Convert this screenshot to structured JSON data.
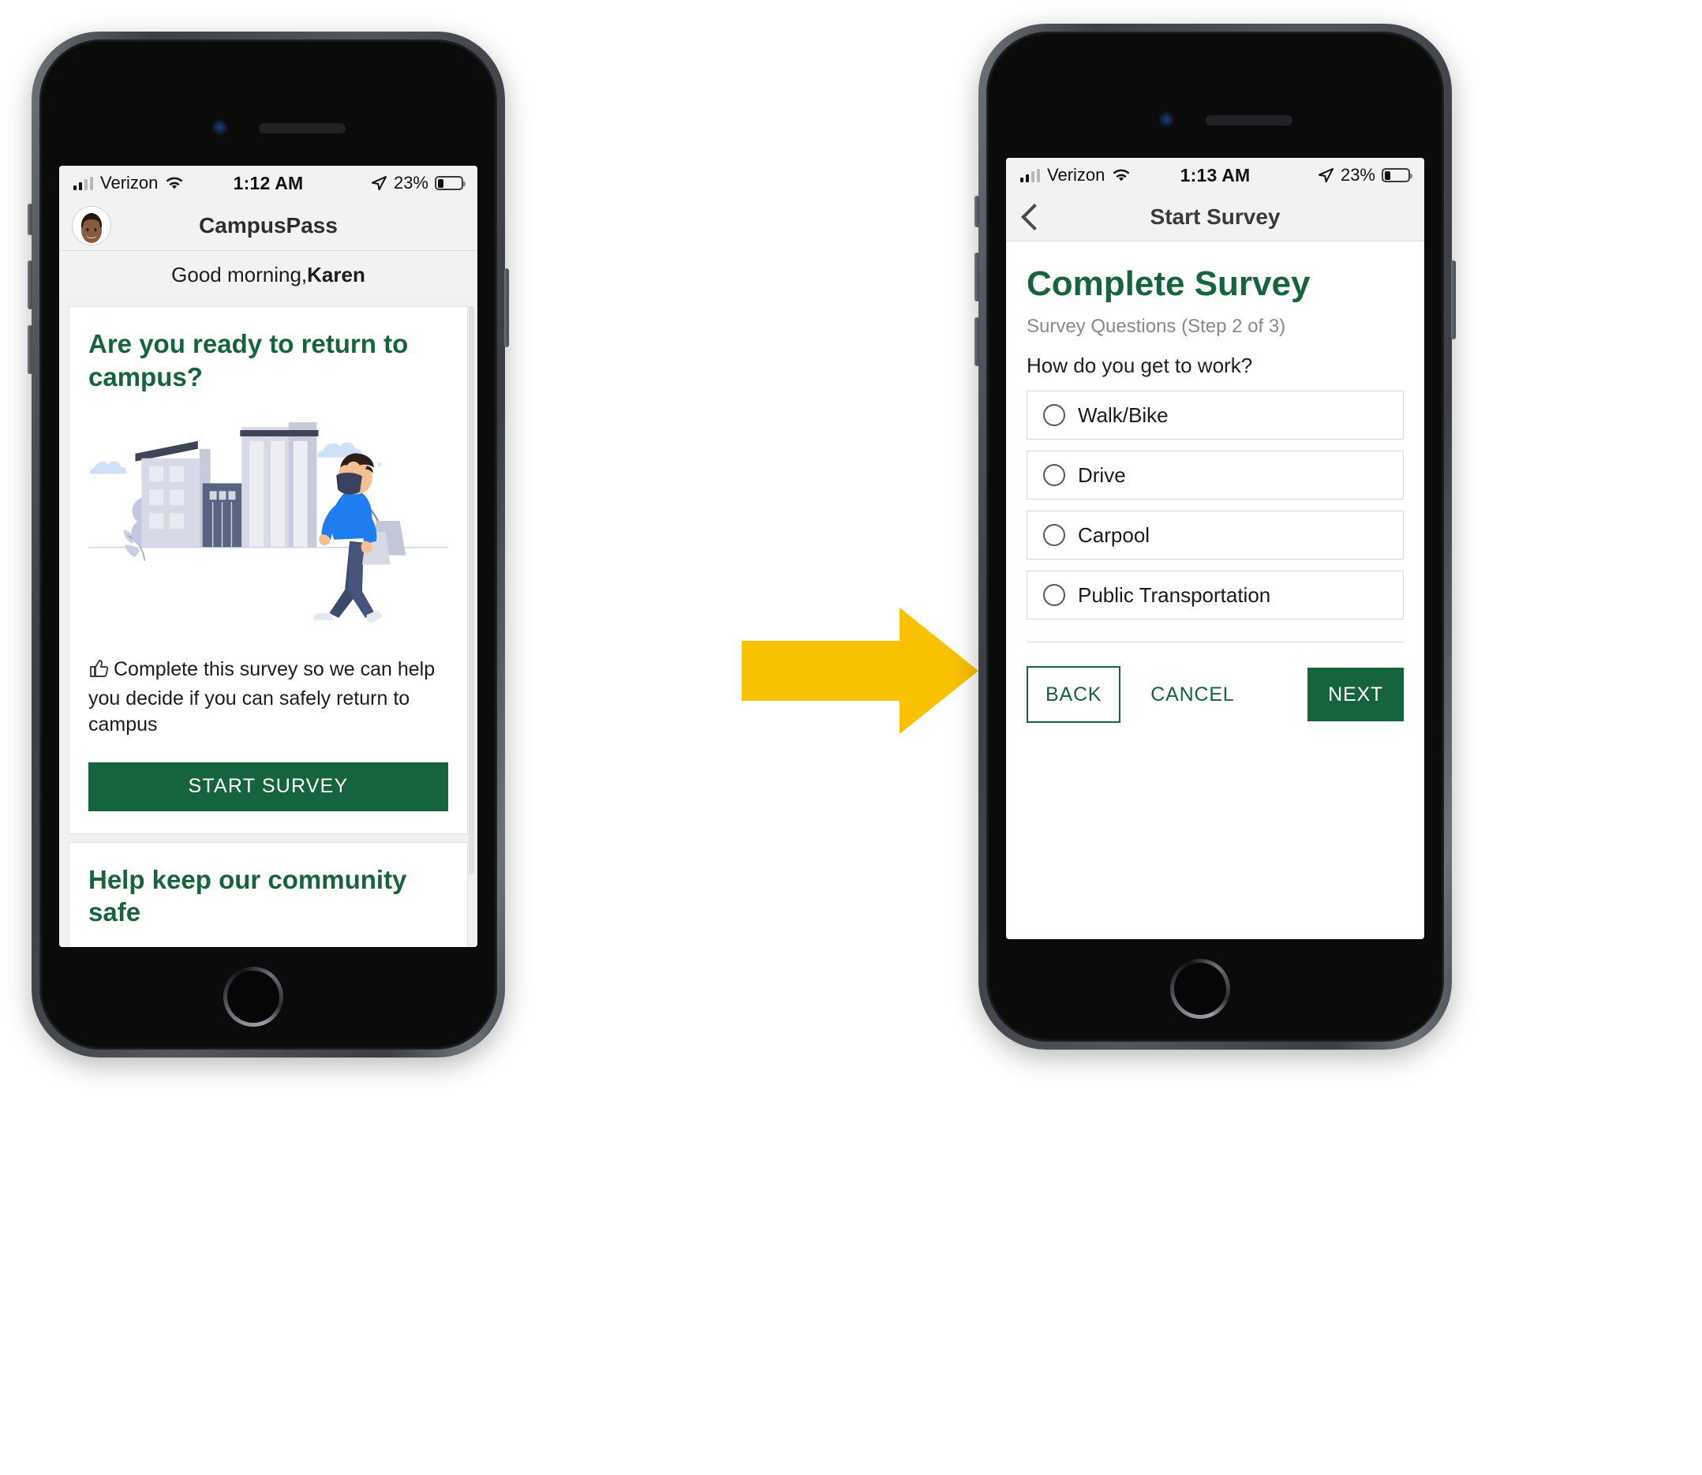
{
  "accent_green": "#16643d",
  "arrow_color": "#F8C200",
  "arrow": {
    "icon": "right-arrow-icon",
    "label": "flow arrow"
  },
  "left_phone": {
    "status_bar": {
      "carrier": "Verizon",
      "time": "1:12 AM",
      "battery_percent": "23%",
      "signal_icon": "cellular-signal-icon",
      "wifi_icon": "wifi-icon",
      "location_icon": "location-arrow-icon",
      "battery_icon": "battery-icon"
    },
    "app_bar": {
      "title": "CampusPass",
      "avatar_icon": "user-avatar"
    },
    "greeting": {
      "prefix": "Good morning, ",
      "name": "Karen"
    },
    "card_primary": {
      "heading": "Are you ready to return to campus?",
      "illustration_icon": "person-walking-with-mask-illustration",
      "body_icon": "thumbs-up-icon",
      "body": "Complete this survey so we can help you decide if you can safely return to campus",
      "cta_label": "START SURVEY"
    },
    "card_secondary": {
      "heading": "Help keep our community safe"
    }
  },
  "right_phone": {
    "status_bar": {
      "carrier": "Verizon",
      "time": "1:13 AM",
      "battery_percent": "23%",
      "signal_icon": "cellular-signal-icon",
      "wifi_icon": "wifi-icon",
      "location_icon": "location-arrow-icon",
      "battery_icon": "battery-icon"
    },
    "nav_bar": {
      "title": "Start Survey",
      "back_icon": "chevron-left-icon"
    },
    "survey": {
      "heading": "Complete Survey",
      "step_label": "Survey Questions (Step 2 of 3)",
      "question": "How do you get to work?",
      "options": [
        {
          "label": "Walk/Bike",
          "selected": false
        },
        {
          "label": "Drive",
          "selected": false
        },
        {
          "label": "Carpool",
          "selected": false
        },
        {
          "label": "Public Transportation",
          "selected": false
        }
      ],
      "back_label": "BACK",
      "cancel_label": "CANCEL",
      "next_label": "NEXT"
    }
  }
}
